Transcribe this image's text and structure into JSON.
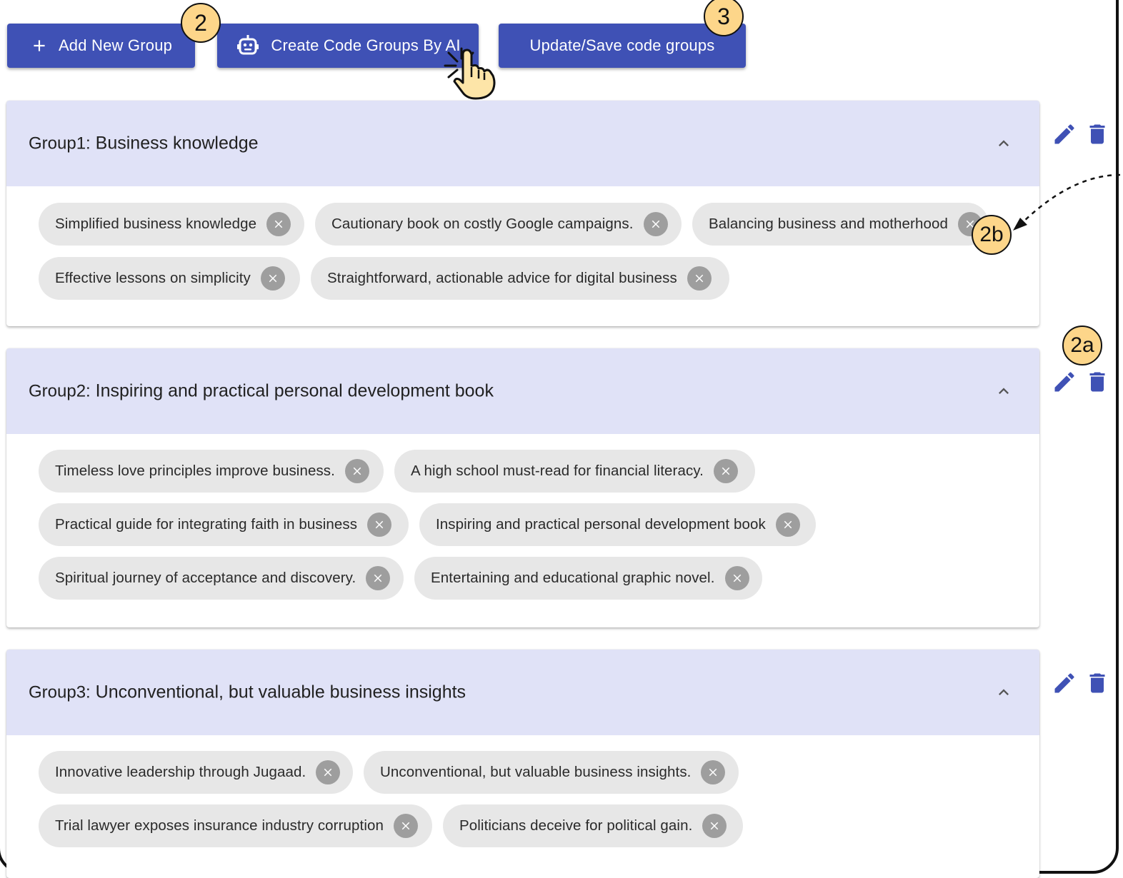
{
  "toolbar": {
    "add_group_label": "Add New Group",
    "create_ai_label": "Create Code Groups By AI",
    "update_label": "Update/Save code groups"
  },
  "annotations": {
    "b2": "2",
    "b3": "3",
    "b2b": "2b",
    "b2a": "2a"
  },
  "groups": [
    {
      "prefix": "Group1:",
      "name": "Business knowledge",
      "codes": [
        "Simplified business knowledge",
        "Cautionary book on costly Google campaigns.",
        "Balancing business and motherhood",
        "Effective lessons on simplicity",
        "Straightforward, actionable advice for digital business"
      ]
    },
    {
      "prefix": "Group2:",
      "name": "Inspiring and practical personal development book",
      "codes": [
        "Timeless love principles improve business.",
        "A high school must-read for financial literacy.",
        "Practical guide for integrating faith in business",
        "Inspiring and practical personal development book",
        "Spiritual journey of acceptance and discovery.",
        "Entertaining and educational graphic novel."
      ]
    },
    {
      "prefix": "Group3:",
      "name": "Unconventional, but valuable business insights",
      "codes": [
        "Innovative leadership through Jugaad.",
        "Unconventional, but valuable business insights.",
        "Trial lawyer exposes insurance industry corruption",
        "Politicians deceive for political gain."
      ]
    }
  ],
  "colors": {
    "primary": "#3f51b5",
    "group_header": "#e0e2f7",
    "chip": "#e7e7e7",
    "badge": "#fdd68a"
  }
}
